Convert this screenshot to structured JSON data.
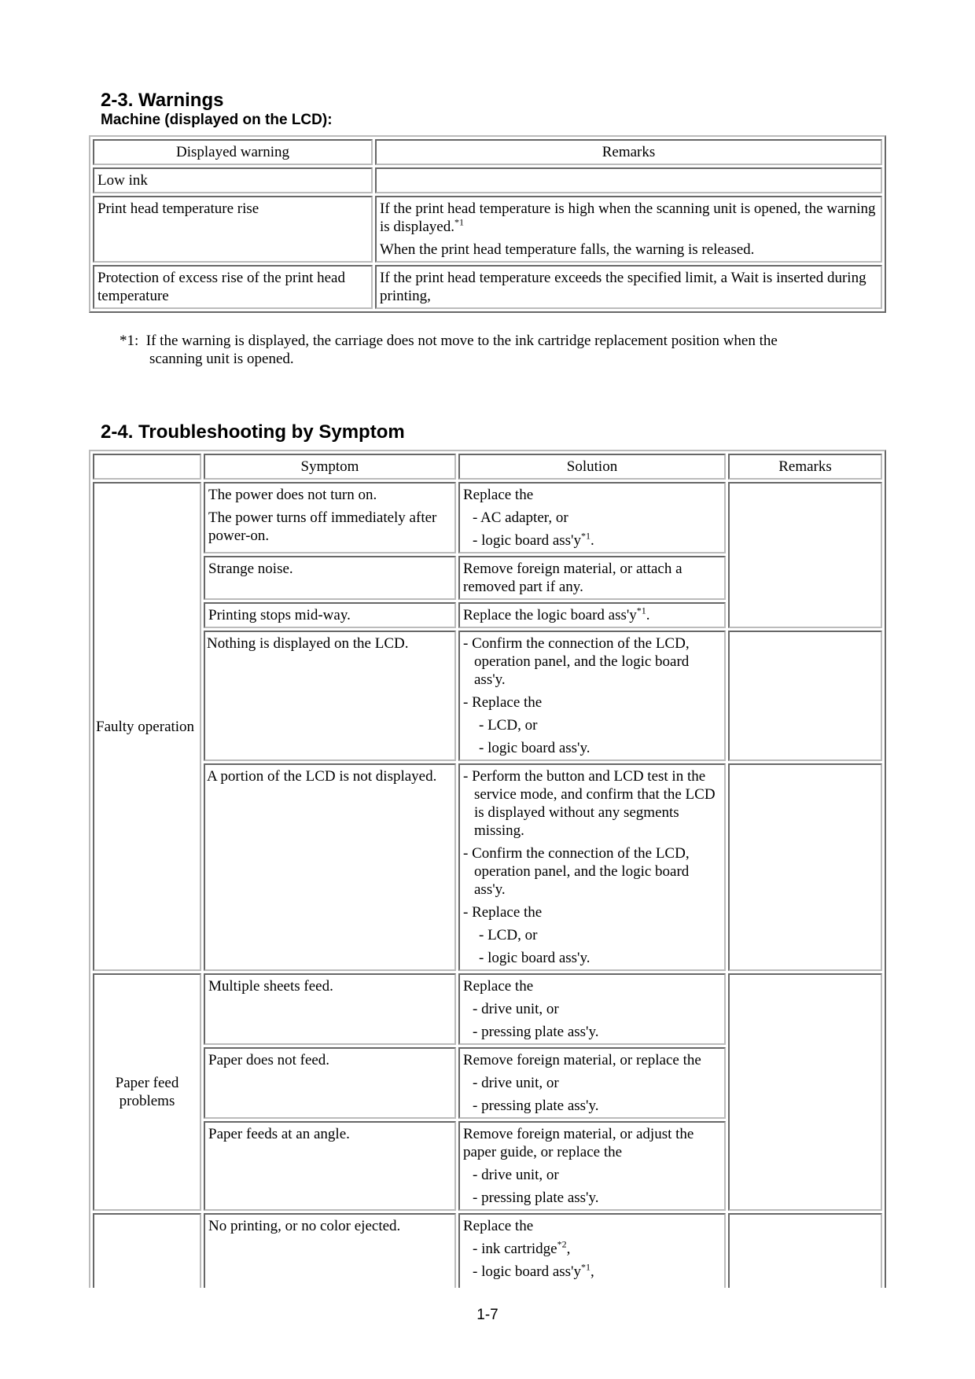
{
  "warnings": {
    "title": "2-3.  Warnings",
    "subtitle": "Machine (displayed on the LCD):",
    "headers": [
      "Displayed warning",
      "Remarks"
    ],
    "rows": [
      {
        "warning": "Low ink",
        "remarks": []
      },
      {
        "warning": "Print head temperature rise",
        "remarks": [
          "If the print head temperature is high when the scanning unit is opened, the warning is displayed.",
          "When the print head temperature falls, the warning is released."
        ],
        "note": "*1"
      },
      {
        "warning": "Protection of excess rise of the print head temperature",
        "remarks": [
          "If the print head temperature exceeds the specified limit, a Wait is inserted during printing,"
        ]
      }
    ],
    "footnote_mark": "*1:",
    "footnote_line1": "If the warning is displayed, the carriage does not move to the ink cartridge replacement position when the",
    "footnote_line2": "scanning unit is opened."
  },
  "troubleshooting": {
    "title": "2-4.  Troubleshooting by Symptom",
    "headers": [
      "",
      "Symptom",
      "Solution",
      "Remarks"
    ],
    "groups": {
      "faulty": "Faulty operation",
      "paper": "Paper feed problems",
      "print": ""
    },
    "r1": {
      "s1": "The power does not turn on.",
      "s2": "The power turns off immediately after power-on.",
      "a": "Replace the",
      "b": "- AC adapter, or",
      "c": "- logic board ass'y",
      "c_note": "*1",
      "c_end": "."
    },
    "r2": {
      "s": "Strange noise.",
      "a": "Remove foreign material, or attach a removed part if any."
    },
    "r3": {
      "s": "Printing stops mid-way.",
      "a": "Replace the logic board ass'y",
      "a_note": "*1",
      "a_end": "."
    },
    "r4": {
      "s": "Nothing is displayed on the LCD.",
      "a": "- Confirm the connection of the LCD, operation panel, and the logic board ass'y.",
      "b": "- Replace the",
      "c": "- LCD, or",
      "d": "- logic board ass'y."
    },
    "r5": {
      "s": "A portion of the LCD is not displayed.",
      "a": "- Perform the button and LCD test in the service mode, and confirm that the LCD is displayed without any segments missing.",
      "b": "- Confirm the connection of  the LCD, operation panel, and the logic board ass'y.",
      "c": "- Replace the",
      "d": "- LCD, or",
      "e": "- logic board ass'y."
    },
    "r6": {
      "s": "Multiple sheets feed.",
      "a": "Replace the",
      "b": "- drive unit, or",
      "c": "- pressing plate ass'y."
    },
    "r7": {
      "s": "Paper does not feed.",
      "a": "Remove foreign material, or replace the",
      "b": "- drive unit, or",
      "c": "- pressing plate ass'y."
    },
    "r8": {
      "s": "Paper feeds at an angle.",
      "a": "Remove foreign material, or adjust the paper guide, or replace the",
      "b": "- drive unit, or",
      "c": "- pressing plate ass'y."
    },
    "r9": {
      "s": "No printing, or no color ejected.",
      "a": "Replace the",
      "b": "- ink cartridge",
      "b_note": "*2",
      "b_end": ",",
      "c": "- logic board ass'y",
      "c_note": "*1",
      "c_end": ","
    }
  },
  "page_number": "1-7"
}
